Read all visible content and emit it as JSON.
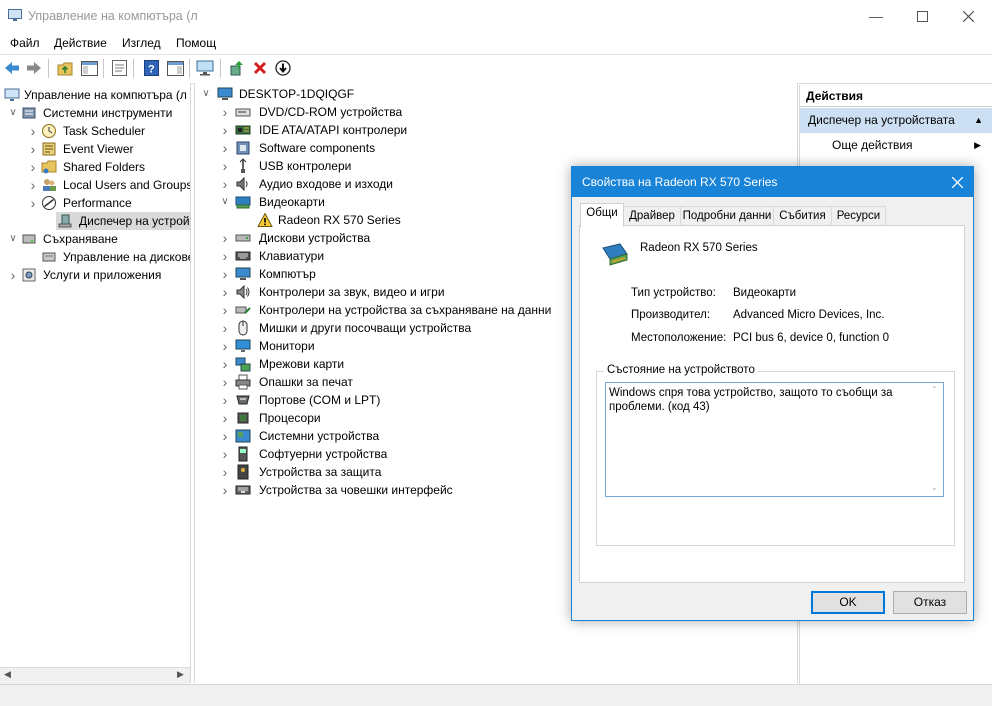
{
  "window": {
    "title": "Управление на компютъра (л"
  },
  "menu": [
    "Файл",
    "Действие",
    "Изглед",
    "Помощ"
  ],
  "left_tree": [
    {
      "label": "Управление на компютъра (л",
      "level": 0,
      "expanded": "none",
      "icon": "computer-management-icon"
    },
    {
      "label": "Системни инструменти",
      "level": 1,
      "expanded": "open",
      "icon": "tools-icon"
    },
    {
      "label": "Task Scheduler",
      "level": 2,
      "expanded": "closed",
      "icon": "clock-icon"
    },
    {
      "label": "Event Viewer",
      "level": 2,
      "expanded": "closed",
      "icon": "event-viewer-icon"
    },
    {
      "label": "Shared Folders",
      "level": 2,
      "expanded": "closed",
      "icon": "shared-folder-icon"
    },
    {
      "label": "Local Users and Groups",
      "level": 2,
      "expanded": "closed",
      "icon": "users-icon"
    },
    {
      "label": "Performance",
      "level": 2,
      "expanded": "closed",
      "icon": "performance-icon"
    },
    {
      "label": "Диспечер на устройстi",
      "level": 2,
      "expanded": "none",
      "icon": "device-manager-icon",
      "selected": true
    },
    {
      "label": "Съхраняване",
      "level": 1,
      "expanded": "open",
      "icon": "storage-icon"
    },
    {
      "label": "Управление на дискове",
      "level": 2,
      "expanded": "none",
      "icon": "disk-management-icon"
    },
    {
      "label": "Услуги и приложения",
      "level": 1,
      "expanded": "closed",
      "icon": "services-icon"
    }
  ],
  "device_tree": {
    "root": "DESKTOP-1DQIQGF",
    "categories": [
      {
        "label": "DVD/CD-ROM устройства",
        "icon": "dvd-icon",
        "expanded": false
      },
      {
        "label": "IDE ATA/ATAPI контролери",
        "icon": "ide-controller-icon",
        "expanded": false
      },
      {
        "label": "Software components",
        "icon": "software-component-icon",
        "expanded": false
      },
      {
        "label": "USB контролери",
        "icon": "usb-icon",
        "expanded": false
      },
      {
        "label": "Аудио входове и изходи",
        "icon": "audio-icon",
        "expanded": false
      },
      {
        "label": "Видеокарти",
        "icon": "display-adapter-icon",
        "expanded": true
      },
      {
        "label": "Radeon RX 570 Series",
        "icon": "warning-icon",
        "child": true
      },
      {
        "label": "Дискови устройства",
        "icon": "disk-drive-icon",
        "expanded": false
      },
      {
        "label": "Клавиатури",
        "icon": "keyboard-icon",
        "expanded": false
      },
      {
        "label": "Компютър",
        "icon": "computer-icon",
        "expanded": false
      },
      {
        "label": "Контролери за звук, видео и игри",
        "icon": "sound-icon",
        "expanded": false
      },
      {
        "label": "Контролери на устройства за съхраняване на данни",
        "icon": "storage-controller-icon",
        "expanded": false
      },
      {
        "label": "Мишки и други посочващи устройства",
        "icon": "mouse-icon",
        "expanded": false
      },
      {
        "label": "Монитори",
        "icon": "monitor-icon",
        "expanded": false
      },
      {
        "label": "Мрежови карти",
        "icon": "network-adapter-icon",
        "expanded": false
      },
      {
        "label": "Опашки за печат",
        "icon": "printer-icon",
        "expanded": false
      },
      {
        "label": "Портове (COM и LPT)",
        "icon": "port-icon",
        "expanded": false
      },
      {
        "label": "Процесори",
        "icon": "processor-icon",
        "expanded": false
      },
      {
        "label": "Системни устройства",
        "icon": "system-device-icon",
        "expanded": false
      },
      {
        "label": "Софтуерни устройства",
        "icon": "software-device-icon",
        "expanded": false
      },
      {
        "label": "Устройства за защита",
        "icon": "security-device-icon",
        "expanded": false
      },
      {
        "label": "Устройства за човешки интерфейс",
        "icon": "hid-icon",
        "expanded": false
      }
    ]
  },
  "actions": {
    "header": "Действия",
    "section": "Диспечер на устройствата",
    "more": "Още действия"
  },
  "dialog": {
    "title": "Свойства на Radeon RX 570 Series",
    "tabs": [
      "Общи",
      "Драйвер",
      "Подробни данни",
      "Събития",
      "Ресурси"
    ],
    "active_tab": 0,
    "device_name": "Radeon RX 570 Series",
    "props": [
      {
        "label": "Тип устройство:",
        "value": "Видеокарти"
      },
      {
        "label": "Производител:",
        "value": "Advanced Micro Devices, Inc."
      },
      {
        "label": "Местоположение:",
        "value": "PCI bus 6, device 0, function 0"
      }
    ],
    "status_group": "Състояние на устройството",
    "status_text": "Windows спря това устройство, защото то съобщи за проблеми. (код 43)",
    "ok": "OK",
    "cancel": "Отказ"
  },
  "colors": {
    "accent": "#1883d7",
    "selection": "#cde0f3",
    "tree_selected": "#d9d9d9"
  }
}
